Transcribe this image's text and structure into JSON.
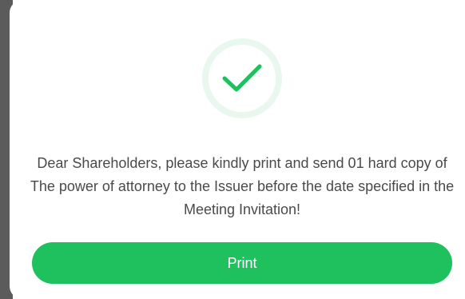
{
  "dialog": {
    "icon": "checkmark-success-icon",
    "message": "Dear Shareholders, please kindly print and send 01 hard copy of The power of attorney to the Issuer before the date specified in the Meeting Invitation!",
    "print_label": "Print"
  },
  "colors": {
    "accent": "#1ec15e",
    "icon_ring": "#e9f8ee",
    "text": "#4a4a4a"
  }
}
